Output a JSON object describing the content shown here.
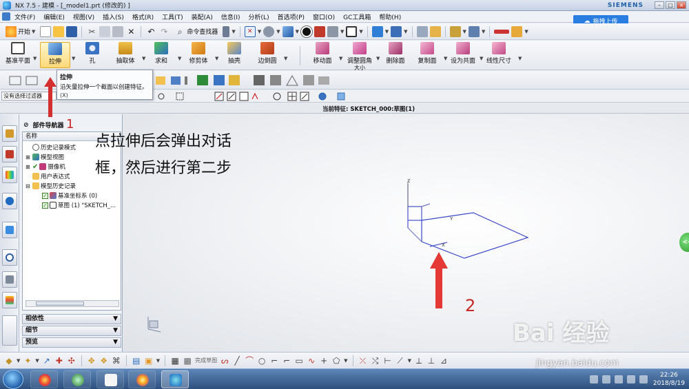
{
  "window": {
    "title": "NX 7.5 - 建模 - [_model1.prt (修改的) ]",
    "brand": "SIEMENS",
    "cloud_upload": "拖拽上传"
  },
  "menu": [
    "文件(F)",
    "编辑(E)",
    "视图(V)",
    "插入(S)",
    "格式(R)",
    "工具(T)",
    "装配(A)",
    "信息(I)",
    "分析(L)",
    "首选项(P)",
    "窗口(O)",
    "GC工具箱",
    "帮助(H)"
  ],
  "toolbar1": {
    "start_label": "开始",
    "command_finder": "命令查找器"
  },
  "ribbon": {
    "items": [
      {
        "label": "基准平面"
      },
      {
        "label": "拉伸"
      },
      {
        "label": "孔"
      },
      {
        "label": "抽取体"
      },
      {
        "label": "求和"
      },
      {
        "label": "修剪体"
      },
      {
        "label": "抽壳"
      },
      {
        "label": "边倒圆"
      },
      {
        "label": "移动面"
      },
      {
        "label": "调整圆角",
        "sub": "大小"
      },
      {
        "label": "删除面"
      },
      {
        "label": "复制面"
      },
      {
        "label": "设为共面"
      },
      {
        "label": "线性尺寸"
      }
    ]
  },
  "tooltip": {
    "title": "拉伸",
    "description": "沿矢量拉伸一个截面以创建特征。",
    "shortcut": "(X)"
  },
  "selection_filter": "没有选择过滤器",
  "status": {
    "current_feature": "当前特征: SKETCH_000:草图(1)"
  },
  "navigator": {
    "title": "部件导航器",
    "column_header": "名称",
    "tree": [
      {
        "label": "历史记录模式",
        "indent": 0
      },
      {
        "label": "模型视图",
        "indent": 0
      },
      {
        "label": "摄像机",
        "indent": 0
      },
      {
        "label": "用户表达式",
        "indent": 0
      },
      {
        "label": "模型历史记录",
        "indent": 0
      },
      {
        "label": "基准坐标系 (0)",
        "indent": 1
      },
      {
        "label": "草图 (1) \"SKETCH_...",
        "indent": 1
      }
    ],
    "panels": [
      "相依性",
      "细节",
      "预览"
    ]
  },
  "annotations": {
    "step1_number": "1",
    "step2_number": "2",
    "note_line1": "点拉伸后会弹出对话",
    "note_line2": "框，然后进行第二步"
  },
  "viewport": {
    "axis_z": "z",
    "axis_y": "Y",
    "axis_x": "X",
    "right_tab": "<<"
  },
  "bottom_toolbar": {
    "finish_sketch": "完成草图"
  },
  "taskbar": {
    "time": "22:26",
    "date": "2018/8/19"
  },
  "watermark": {
    "brand": "Bai 经验",
    "url": "jingyan.baidu.com"
  }
}
